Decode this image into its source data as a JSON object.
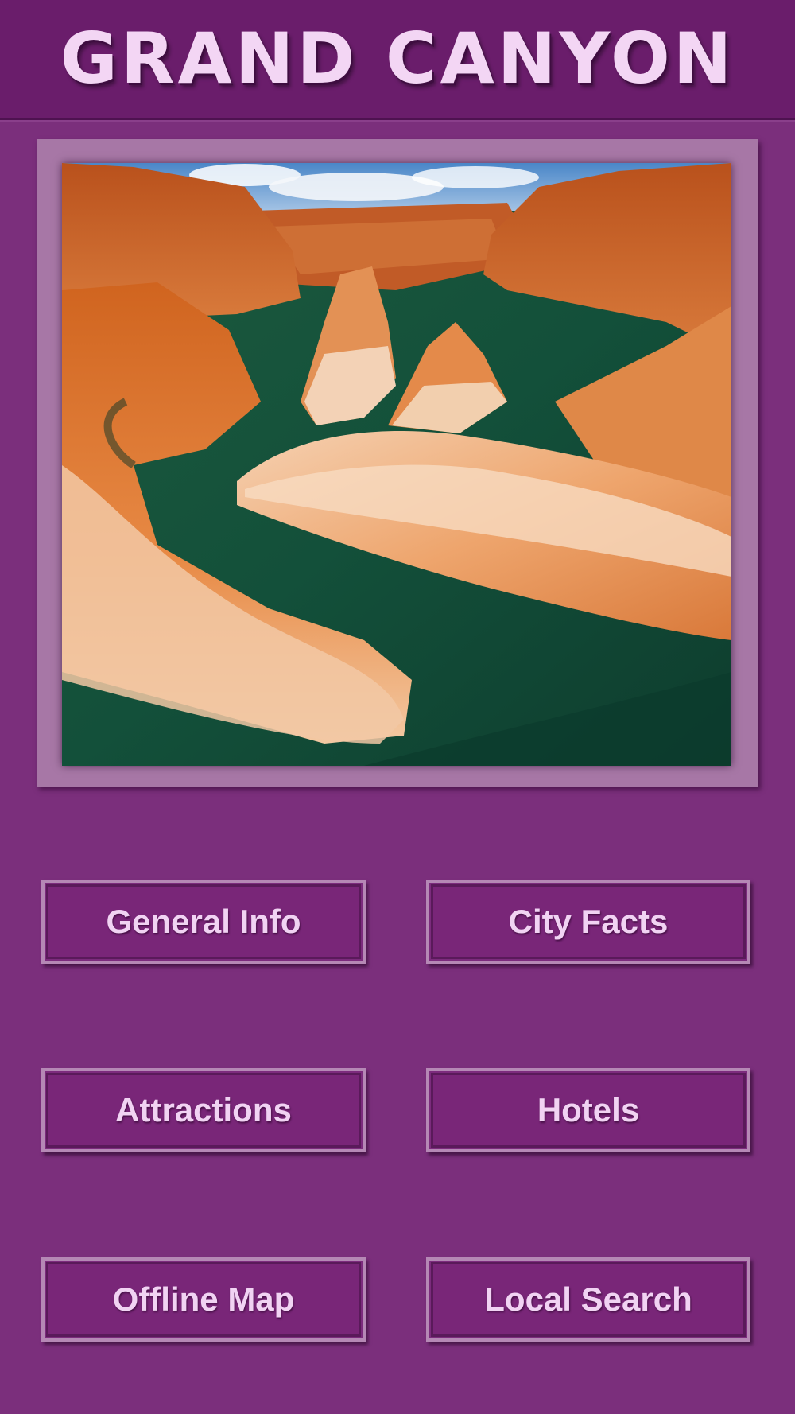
{
  "header": {
    "title": "GRAND CANYON"
  },
  "hero": {
    "image_subject": "canyon river bend photo"
  },
  "menu": {
    "general_info": "General Info",
    "city_facts": "City Facts",
    "attractions": "Attractions",
    "hotels": "Hotels",
    "offline_map": "Offline Map",
    "local_search": "Local Search"
  },
  "colors": {
    "background": "#7b2f7c",
    "header": "#6a1d6b",
    "title_text": "#f3d6f4",
    "button_border": "#b588b5",
    "button_text": "#f1d3f3"
  }
}
